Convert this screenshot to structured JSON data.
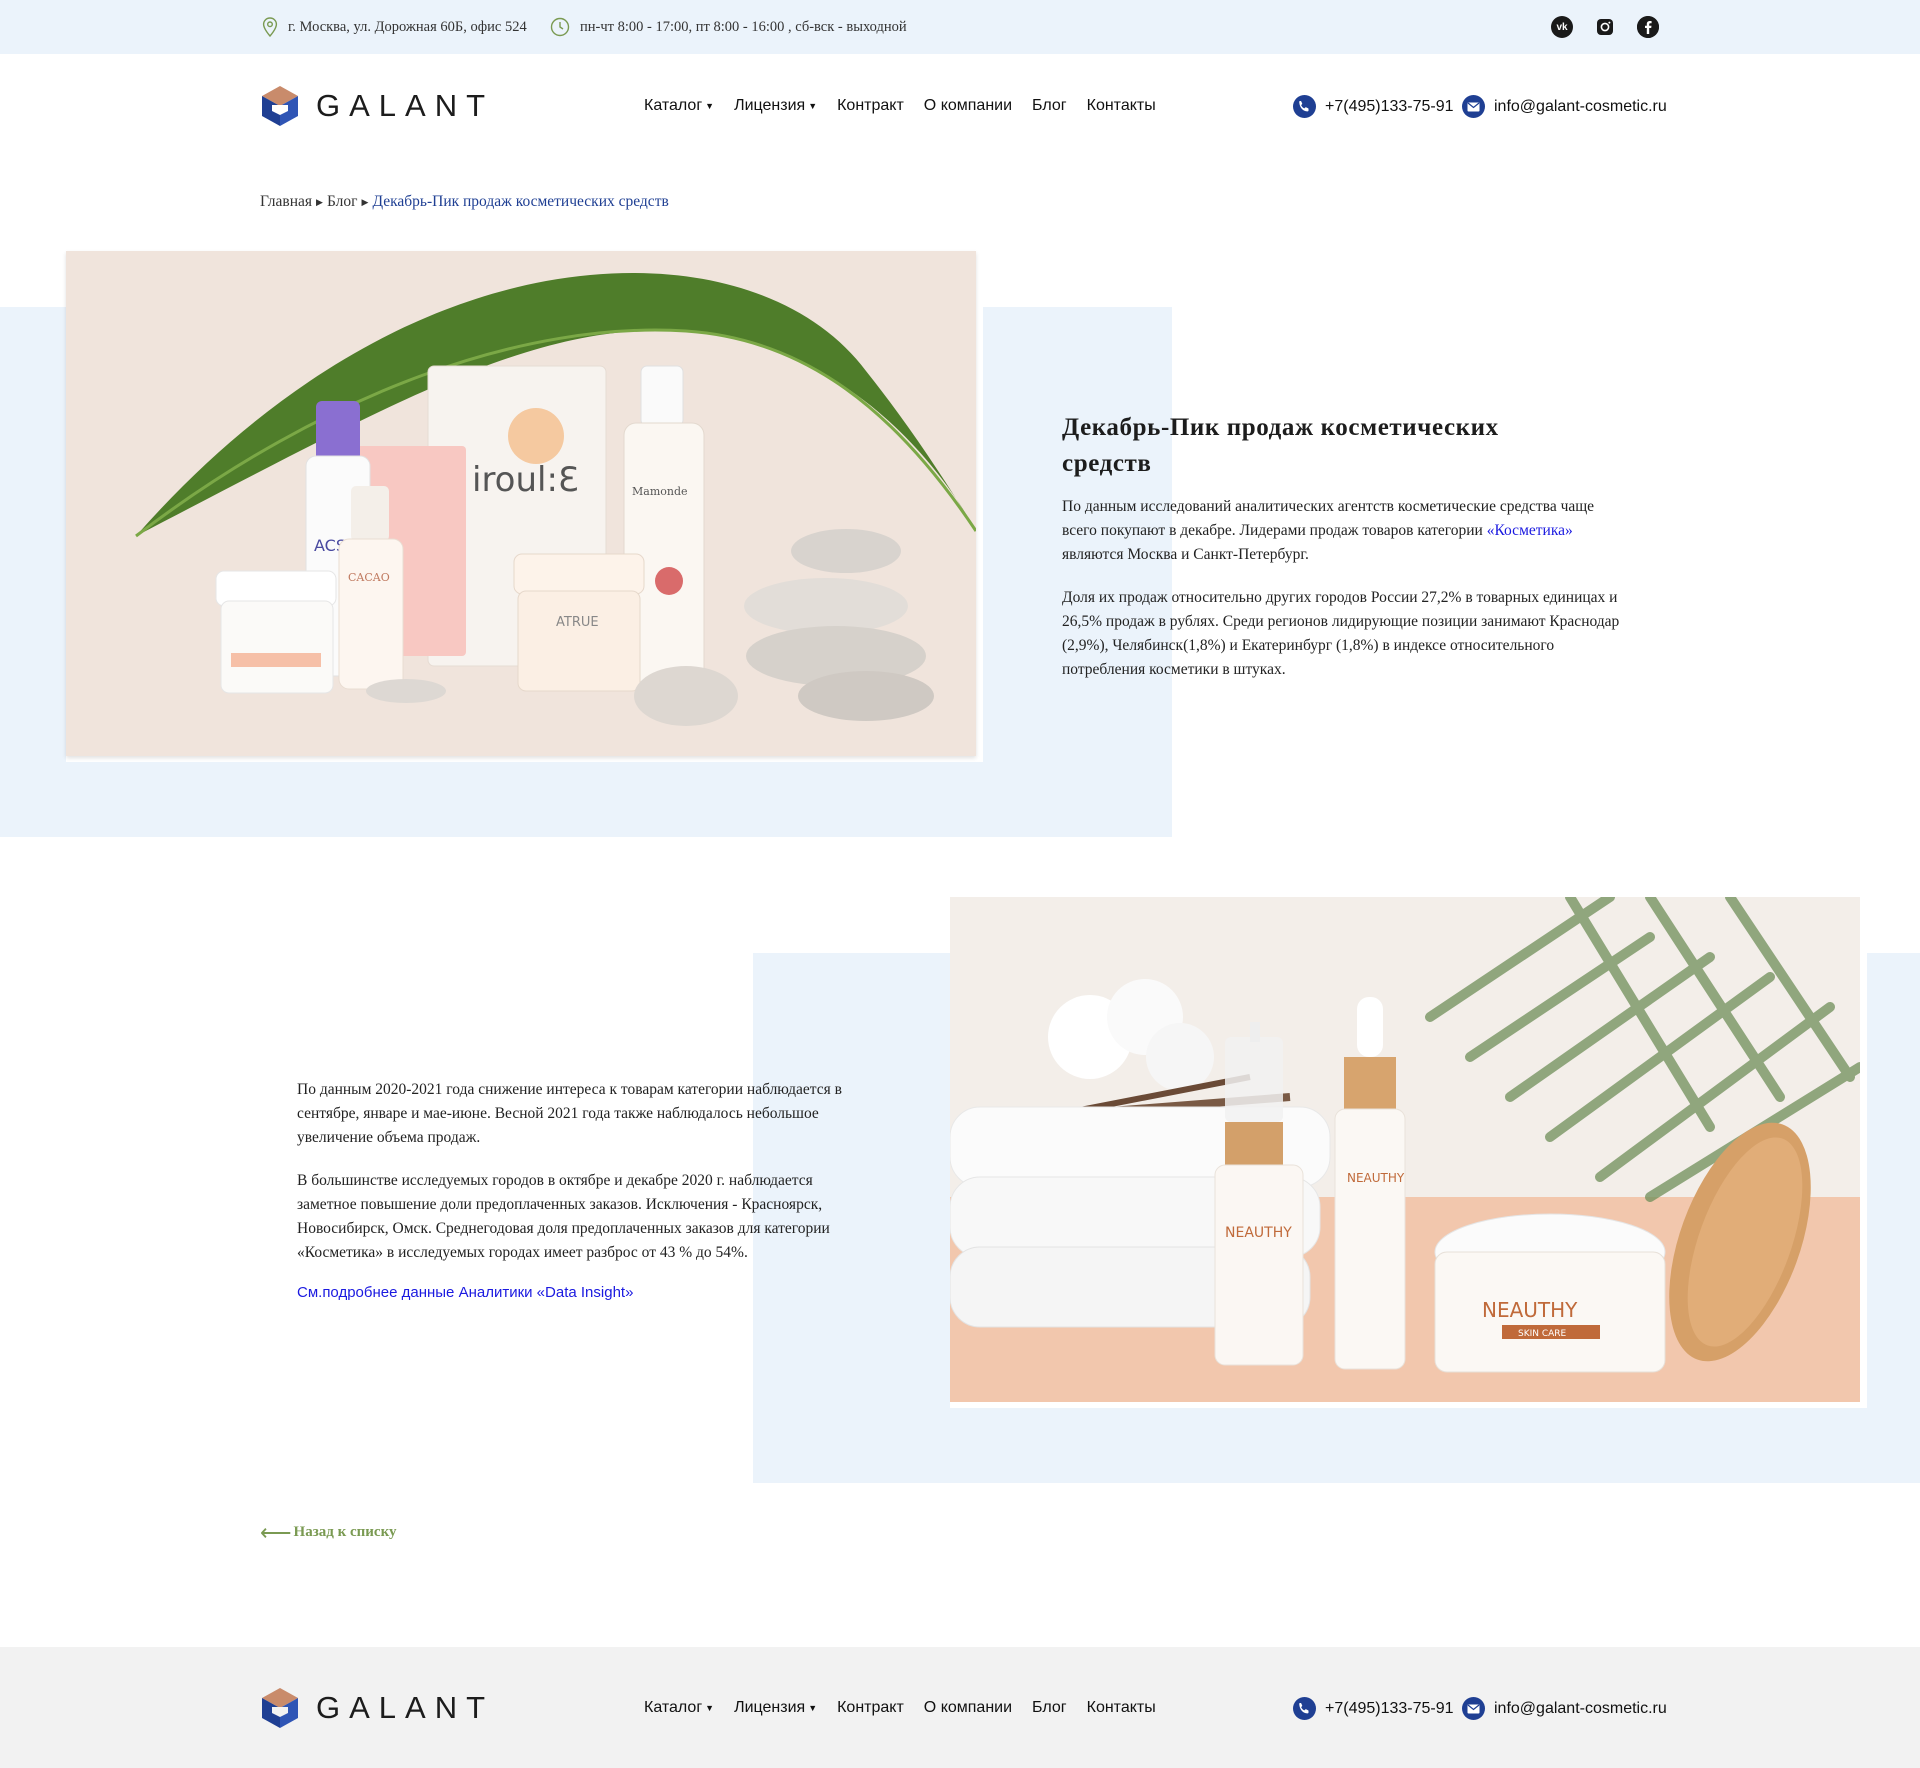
{
  "topbar": {
    "address": "г. Москва, ул. Дорожная 60Б, офис 524",
    "hours": "пн-чт 8:00 - 17:00, пт 8:00 - 16:00 , сб-вск - выходной",
    "social": [
      "vk-icon",
      "instagram-icon",
      "facebook-icon"
    ]
  },
  "header": {
    "logo_text": "GALANT",
    "nav": [
      {
        "label": "Каталог",
        "dropdown": true
      },
      {
        "label": "Лицензия",
        "dropdown": true
      },
      {
        "label": "Контракт",
        "dropdown": false
      },
      {
        "label": "О компании",
        "dropdown": false
      },
      {
        "label": "Блог",
        "dropdown": false
      },
      {
        "label": "Контакты",
        "dropdown": false
      }
    ],
    "phone": "+7(495)133-75-91",
    "email": "info@galant-cosmetic.ru"
  },
  "breadcrumb": {
    "home": "Главная",
    "blog": "Блог",
    "current": "Декабрь-Пик продаж косметических средств"
  },
  "article": {
    "title": "Декабрь-Пик продаж косметических средств",
    "p1_before": "По данным исследований аналитических агентств косметические средства чаще всего покупают в декабре. Лидерами продаж товаров категории ",
    "p1_link": "«Косметика»",
    "p1_after": " являются Москва и Санкт-Петербург.",
    "p2": "Доля их продаж относительно других городов России 27,2% в товарных единицах и 26,5% продаж в рублях. Среди регионов лидирующие позиции занимают Краснодар (2,9%), Челябинск(1,8%) и Екатеринбург (1,8%) в индексе относительного потребления косметики в штуках.",
    "p3": "По данным 2020-2021 года снижение интереса к товарам категории наблюдается в сентябре, январе и мае-июне. Весной 2021 года также наблюдалось небольшое увеличение объема продаж.",
    "p4": "В большинстве исследуемых городов в октябре и декабре 2020 г. наблюдается заметное повышение доли предоплаченных заказов. Исключения - Красноярск, Новосибирск, Омск. Среднегодовая доля предоплаченных заказов для категории «Косметика» в исследуемых городах имеет разброс от 43 % до 54%.",
    "analytics_link": "См.подробнее данные Аналитики «Data Insight»",
    "back_label": "Назад к списку"
  },
  "product_labels": {
    "atrue": "ATRUE",
    "iroul": "iroul:Ɛ",
    "mamonde": "Mamonde",
    "acs": "ACS",
    "cacao": "CACAO",
    "neauthy": "NEAUTHY",
    "skin_care": "SKIN CARE"
  },
  "colors": {
    "brand_blue": "#1f3f93",
    "light_blue_bg": "#ebf3fb",
    "link": "#1b1ae0",
    "back_green": "#7a9a52",
    "footer_bg": "#f2f2f2"
  }
}
